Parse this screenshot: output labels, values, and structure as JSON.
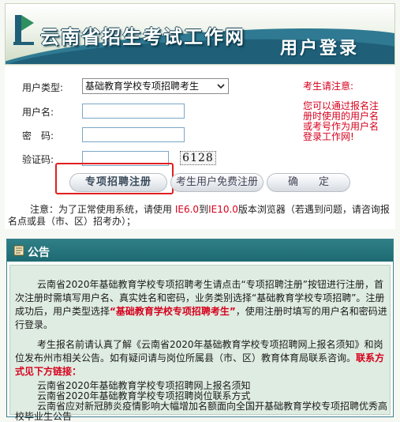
{
  "header": {
    "site_title": "云南省招生考试工作网",
    "login_title": "用户登录"
  },
  "form": {
    "user_type_label": "用户类型:",
    "user_type_value": "基础教育学校专项招聘考生",
    "username_label": "用户名:",
    "password_label": "密　码:",
    "captcha_label": "验证码:",
    "captcha_value": "6128",
    "btn_special_recruit": "专项招聘注册",
    "btn_free_register": "考生用户免费注册",
    "btn_confirm": "确　　定"
  },
  "notice": {
    "title": "考生请注意:",
    "body": "您可以通过报名注册时使用的用户名或考号作为用户名登录工作网!"
  },
  "note": {
    "prefix": "注意：为了正常使用系统，请使用",
    "ie6": "IE6.0",
    "to": "到",
    "ie10": "IE10.0",
    "suffix": "版本浏览器（若遇到问题，请咨询报名点或县（市、区）招考办）；"
  },
  "announcement": {
    "title": "公告",
    "para1_a": "云南省2020年基础教育学校专项招聘考生请点击“专项招聘注册”按钮进行注册，首次注册时需填写用户名、真实姓名和密码，业务类别选择“基础教育学校专项招聘”。注册成功后，用户类型选择",
    "para1_red": "“基础教育学校专项招聘考生”",
    "para1_b": "，使用注册时填写的用户名和密码进行登录。",
    "para2_a": "考生报名前请认真了解《云南省2020年基础教育学校专项招聘网上报名须知》和岗位发布州市相关公告。如有疑问请与岗位所属县（市、区）教育体育局联系咨询。",
    "para2_red": "联系方式见下方链接：",
    "link1": "云南省2020年基础教育学校专项招聘网上报名须知",
    "link2": "云南省2020年基础教育学校专项招聘岗位联系方式",
    "link3": "云南省应对新冠肺炎疫情影响大幅增加名额面向全国开基础教育学校专项招聘优秀高校毕业生公告"
  },
  "colors": {
    "accent_teal": "#1e6a72",
    "alert_red": "#d6001c",
    "panel_green": "#dfece2"
  }
}
